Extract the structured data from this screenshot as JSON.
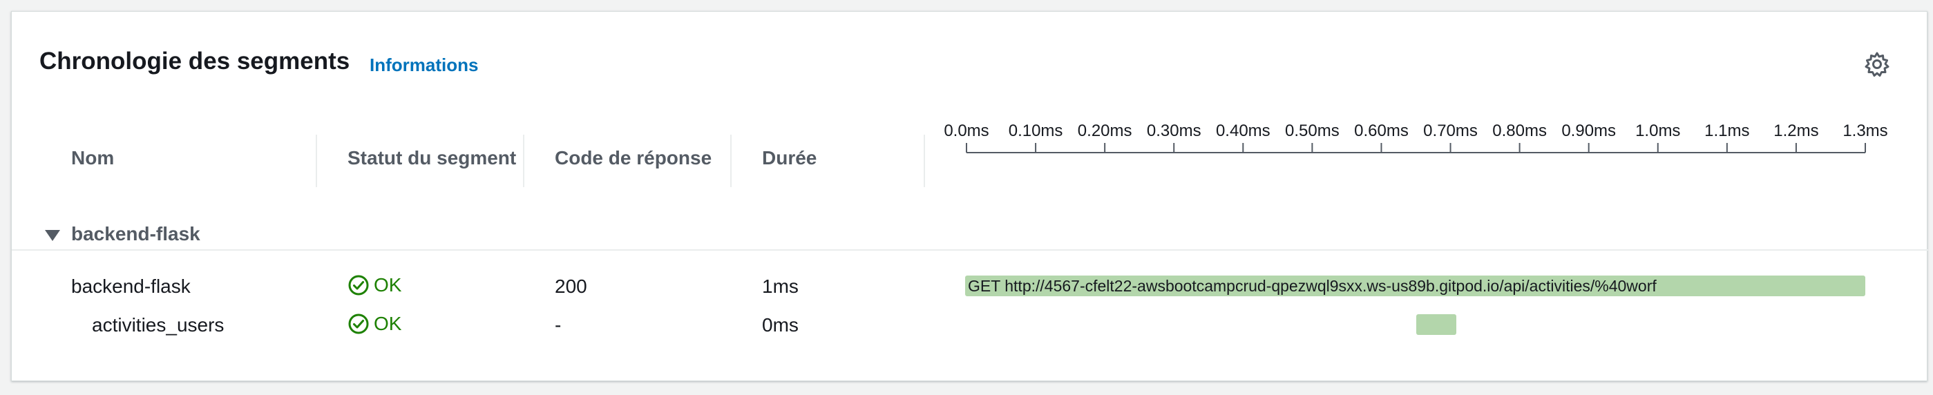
{
  "header": {
    "title": "Chronologie des segments",
    "info_link": "Informations"
  },
  "columns": {
    "name": "Nom",
    "status": "Statut du segment",
    "response_code": "Code de réponse",
    "duration": "Durée"
  },
  "timeline": {
    "ticks": [
      "0.0ms",
      "0.10ms",
      "0.20ms",
      "0.30ms",
      "0.40ms",
      "0.50ms",
      "0.60ms",
      "0.70ms",
      "0.80ms",
      "0.90ms",
      "1.0ms",
      "1.1ms",
      "1.2ms",
      "1.3ms"
    ]
  },
  "group": {
    "name": "backend-flask",
    "rows": [
      {
        "name": "backend-flask",
        "status": "OK",
        "response_code": "200",
        "duration": "1ms",
        "bar_label": "GET http://4567-cfelt22-awsbootcampcrud-qpezwql9sxx.ws-us89b.gitpod.io/api/activities/%40worf"
      },
      {
        "name": "activities_users",
        "status": "OK",
        "response_code": "-",
        "duration": "0ms",
        "bar_label": ""
      }
    ]
  },
  "colors": {
    "accent_link": "#0073bb",
    "status_ok": "#1d8102",
    "bar_fill": "#b3d6ab"
  },
  "icons": {
    "settings": "gear-icon",
    "status_ok": "check-circle-icon",
    "expand": "caret-down-icon"
  }
}
